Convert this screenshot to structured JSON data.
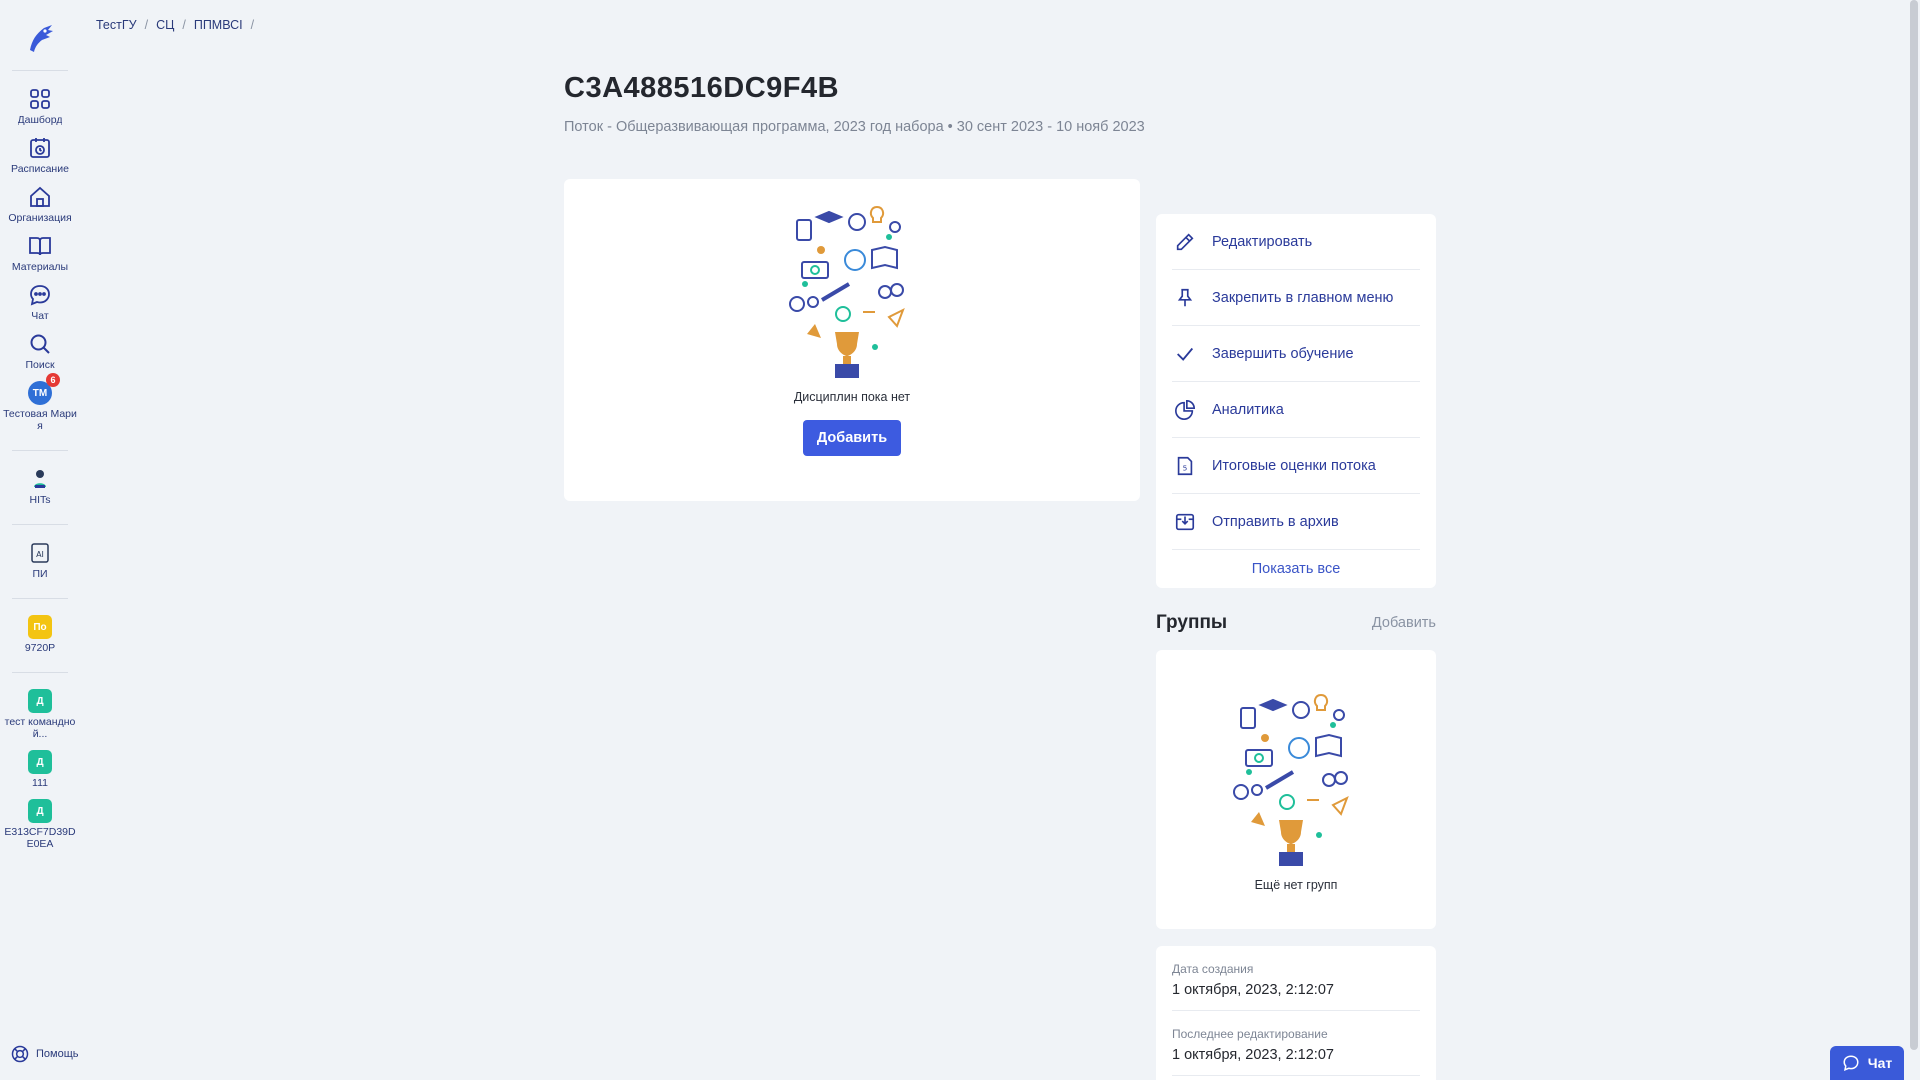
{
  "breadcrumb": [
    "ТестГУ",
    "СЦ",
    "ППМВСI"
  ],
  "sidebar": {
    "items": [
      {
        "label": "Дашборд",
        "icon": "grid-icon"
      },
      {
        "label": "Расписание",
        "icon": "calendar-clock-icon"
      },
      {
        "label": "Организация",
        "icon": "home-icon"
      },
      {
        "label": "Материалы",
        "icon": "book-icon"
      },
      {
        "label": "Чат",
        "icon": "chat-icon"
      },
      {
        "label": "Поиск",
        "icon": "search-icon"
      }
    ],
    "user": {
      "initials": "ТМ",
      "badge": "6",
      "label": "Тестовая Мария"
    },
    "apps": [
      {
        "label": "HITs"
      },
      {
        "label": "ПИ"
      }
    ],
    "spaces": [
      {
        "initials": "По",
        "label": "9720P",
        "color": "yellow"
      },
      {
        "initials": "Д",
        "label": "тест командной...",
        "color": "teal"
      },
      {
        "initials": "Д",
        "label": "111",
        "color": "teal"
      },
      {
        "initials": "Д",
        "label": "E313CF7D39D E0EA",
        "color": "teal"
      }
    ],
    "help_label": "Помощь"
  },
  "page": {
    "title": "C3A488516DC9F4B",
    "subtitle": "Поток - Общеразвивающая программа, 2023 год набора • 30 сент 2023 - 10 нояб 2023"
  },
  "disciplines": {
    "empty_text": "Дисциплин пока нет",
    "add_label": "Добавить"
  },
  "actions": {
    "items": [
      {
        "label": "Редактировать",
        "icon": "pencil-icon"
      },
      {
        "label": "Закрепить в главном меню",
        "icon": "pin-icon"
      },
      {
        "label": "Завершить обучение",
        "icon": "check-icon"
      },
      {
        "label": "Аналитика",
        "icon": "pie-chart-icon"
      },
      {
        "label": "Итоговые оценки потока",
        "icon": "grade-document-icon"
      },
      {
        "label": "Отправить в архив",
        "icon": "archive-icon"
      }
    ],
    "show_all": "Показать все"
  },
  "groups": {
    "title": "Группы",
    "add_label": "Добавить",
    "empty_text": "Ещё нет групп"
  },
  "meta": {
    "created_label": "Дата создания",
    "created_value": "1 октября, 2023, 2:12:07",
    "edited_label": "Последнее редактирование",
    "edited_value": "1 октября, 2023, 2:12:07"
  },
  "chat_widget": {
    "label": "Чат"
  },
  "colors": {
    "primary": "#3d5be0",
    "link": "#2a3a9a",
    "background": "#f0f3f7"
  }
}
